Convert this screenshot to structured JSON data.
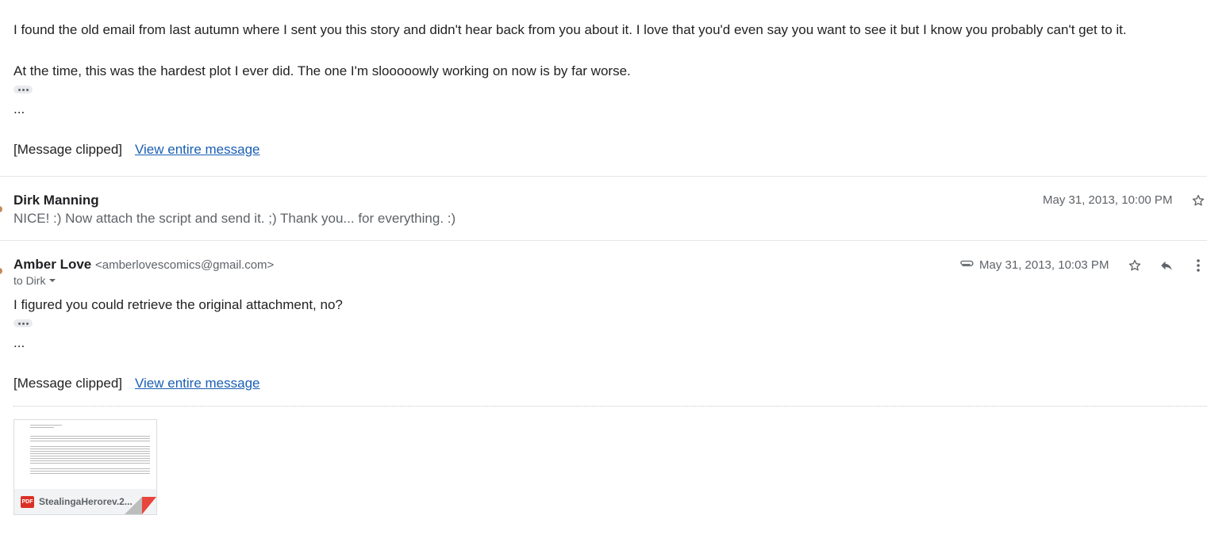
{
  "message1": {
    "paragraph1": "I found the old email from last autumn where I sent you this story and didn't hear back from you about it. I love that you'd even say you want to see it but I know you probably can't get to it.",
    "paragraph2": "At the time, this was the hardest plot I ever did. The one I'm slooooowly working on now is by far worse.",
    "ellipsis": "...",
    "clipped_label": "[Message clipped]",
    "view_entire": "View entire message"
  },
  "message2": {
    "sender": "Dirk Manning",
    "snippet": "NICE! :) Now attach the script and send it. ;) Thank you... for everything. :)",
    "date": "May 31, 2013, 10:00 PM"
  },
  "message3": {
    "sender": "Amber Love",
    "email": "<amberlovescomics@gmail.com>",
    "to_line": "to Dirk",
    "date": "May 31, 2013, 10:03 PM",
    "body": "I figured you could retrieve the original attachment, no?",
    "ellipsis": "...",
    "clipped_label": "[Message clipped]",
    "view_entire": "View entire message",
    "attachment": {
      "badge": "PDF",
      "filename": "StealingaHerorev.2..."
    }
  },
  "icons": {
    "star": "star-icon",
    "reply": "reply-icon",
    "more": "more-vert-icon",
    "attachment": "paperclip-icon",
    "dropdown": "caret-down-icon"
  },
  "colors": {
    "link": "#1a5fb4",
    "pdf": "#d93025"
  }
}
